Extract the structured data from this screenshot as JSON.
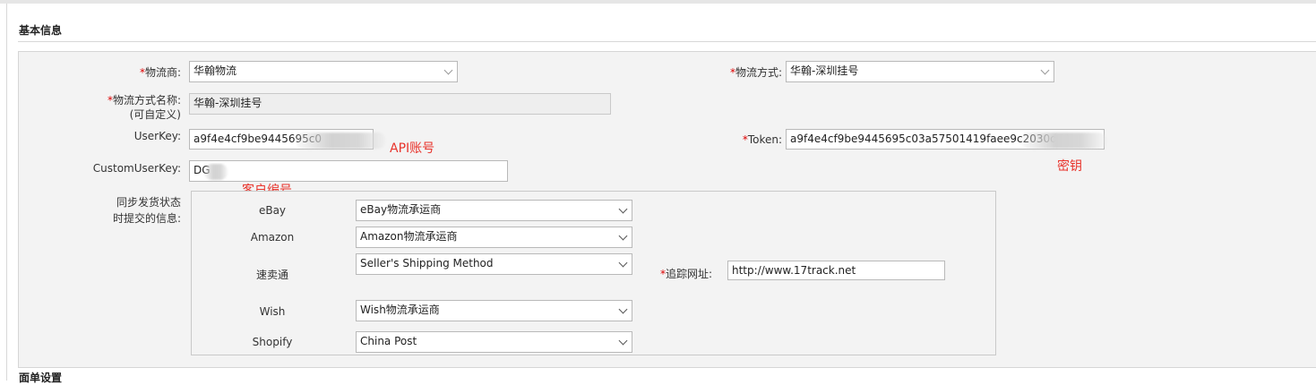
{
  "sections": {
    "basic_info": "基本信息",
    "order_settings": "面单设置"
  },
  "form": {
    "carrier": {
      "required": "*",
      "label": "物流商:",
      "value": "华翰物流"
    },
    "shipping_method": {
      "required": "*",
      "label": "物流方式:",
      "value": "华翰-深圳挂号"
    },
    "method_name": {
      "required": "*",
      "label": "物流方式名称:",
      "sublabel": "(可自定义)",
      "value": "华翰-深圳挂号"
    },
    "userkey": {
      "label": "UserKey:",
      "value": "a9f4e4cf9be9445695c0"
    },
    "token": {
      "required": "*",
      "label": "Token:",
      "value": "a9f4e4cf9be9445695c03a57501419faee9c2030d01"
    },
    "customuserkey": {
      "label": "CustomUserKey:",
      "value": "DG"
    },
    "sync": {
      "label_line1": "同步发货状态",
      "label_line2": "时提交的信息:"
    },
    "tracking_url": {
      "required": "*",
      "label": "追踪网址:",
      "value": "http://www.17track.net"
    }
  },
  "platforms": [
    {
      "name": "eBay",
      "value": "eBay物流承运商"
    },
    {
      "name": "Amazon",
      "value": "Amazon物流承运商"
    },
    {
      "name": "速卖通",
      "value": "Seller's Shipping Method"
    },
    {
      "name": "Wish",
      "value": "Wish物流承运商"
    },
    {
      "name": "Shopify",
      "value": "China Post"
    }
  ],
  "annotations": {
    "api_account": "API账号",
    "secret_key": "密钥",
    "customer_id": "客户编号"
  },
  "colors": {
    "annotation": "#e8332b",
    "required": "#dd0000"
  }
}
